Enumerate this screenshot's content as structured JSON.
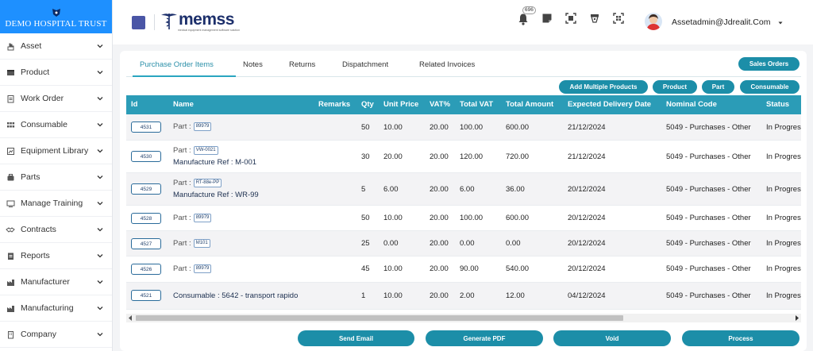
{
  "sidebar": {
    "brand": "DEMO HOSPITAL TRUST",
    "items": [
      {
        "label": "Asset",
        "icon": "hand-icon"
      },
      {
        "label": "Product",
        "icon": "box-icon"
      },
      {
        "label": "Work Order",
        "icon": "clipboard-icon"
      },
      {
        "label": "Consumable",
        "icon": "grid-icon"
      },
      {
        "label": "Equipment Library",
        "icon": "library-icon"
      },
      {
        "label": "Parts",
        "icon": "parts-icon"
      },
      {
        "label": "Manage Training",
        "icon": "monitor-icon"
      },
      {
        "label": "Contracts",
        "icon": "handshake-icon"
      },
      {
        "label": "Reports",
        "icon": "report-icon"
      },
      {
        "label": "Manufacturer",
        "icon": "factory-icon"
      },
      {
        "label": "Manufacturing",
        "icon": "factory-icon"
      },
      {
        "label": "Company",
        "icon": "building-icon"
      }
    ]
  },
  "topbar": {
    "logo": "memss",
    "logo_tagline": "medical equipment management software solution",
    "notification_count": "696",
    "user": "Assetadmin@Jdrealit.Com"
  },
  "tabs": [
    "Purchase Order Items",
    "Notes",
    "Returns",
    "Dispatchment",
    "Related Invoices"
  ],
  "actions": {
    "sales_orders": "Sales Orders",
    "add_multiple": "Add Multiple Products",
    "product": "Product",
    "part": "Part",
    "consumable": "Consumable"
  },
  "table": {
    "headers": [
      "Id",
      "Name",
      "Remarks",
      "Qty",
      "Unit Price",
      "VAT%",
      "Total VAT",
      "Total Amount",
      "Expected Delivery Date",
      "Nominal Code",
      "Status"
    ],
    "rows": [
      {
        "id": "4531",
        "label": "Part :",
        "tag": "89979",
        "mref": "",
        "qty": "50",
        "unit": "10.00",
        "vatp": "20.00",
        "tvat": "100.00",
        "amount": "600.00",
        "date": "21/12/2024",
        "code": "5049 - Purchases - Other",
        "status": "In Progress"
      },
      {
        "id": "4530",
        "label": "Part :",
        "tag": "VW-0021",
        "mref": "Manufacture Ref :  M-001",
        "qty": "30",
        "unit": "20.00",
        "vatp": "20.00",
        "tvat": "120.00",
        "amount": "720.00",
        "date": "21/12/2024",
        "code": "5049 - Purchases - Other",
        "status": "In Progress"
      },
      {
        "id": "4529",
        "label": "Part :",
        "tag": "RT-88e-PP",
        "mref": "Manufacture Ref :  WR-99",
        "qty": "5",
        "unit": "6.00",
        "vatp": "20.00",
        "tvat": "6.00",
        "amount": "36.00",
        "date": "20/12/2024",
        "code": "5049 - Purchases - Other",
        "status": "In Progress"
      },
      {
        "id": "4528",
        "label": "Part :",
        "tag": "89979",
        "mref": "",
        "qty": "50",
        "unit": "10.00",
        "vatp": "20.00",
        "tvat": "100.00",
        "amount": "600.00",
        "date": "20/12/2024",
        "code": "5049 - Purchases - Other",
        "status": "In Progress"
      },
      {
        "id": "4527",
        "label": "Part :",
        "tag": "M101",
        "mref": "",
        "qty": "25",
        "unit": "0.00",
        "vatp": "20.00",
        "tvat": "0.00",
        "amount": "0.00",
        "date": "20/12/2024",
        "code": "5049 - Purchases - Other",
        "status": "In Progress"
      },
      {
        "id": "4526",
        "label": "Part :",
        "tag": "89979",
        "mref": "",
        "qty": "45",
        "unit": "10.00",
        "vatp": "20.00",
        "tvat": "90.00",
        "amount": "540.00",
        "date": "20/12/2024",
        "code": "5049 - Purchases - Other",
        "status": "In Progress"
      },
      {
        "id": "4521",
        "label": "Consumable : 5642 - transport rapido",
        "tag": "",
        "mref": "",
        "qty": "1",
        "unit": "10.00",
        "vatp": "20.00",
        "tvat": "2.00",
        "amount": "12.00",
        "date": "04/12/2024",
        "code": "5049 - Purchases - Other",
        "status": "In Progress"
      }
    ]
  },
  "footer": {
    "send": "Send Email",
    "pdf": "Generate PDF",
    "void": "Void",
    "process": "Process"
  }
}
